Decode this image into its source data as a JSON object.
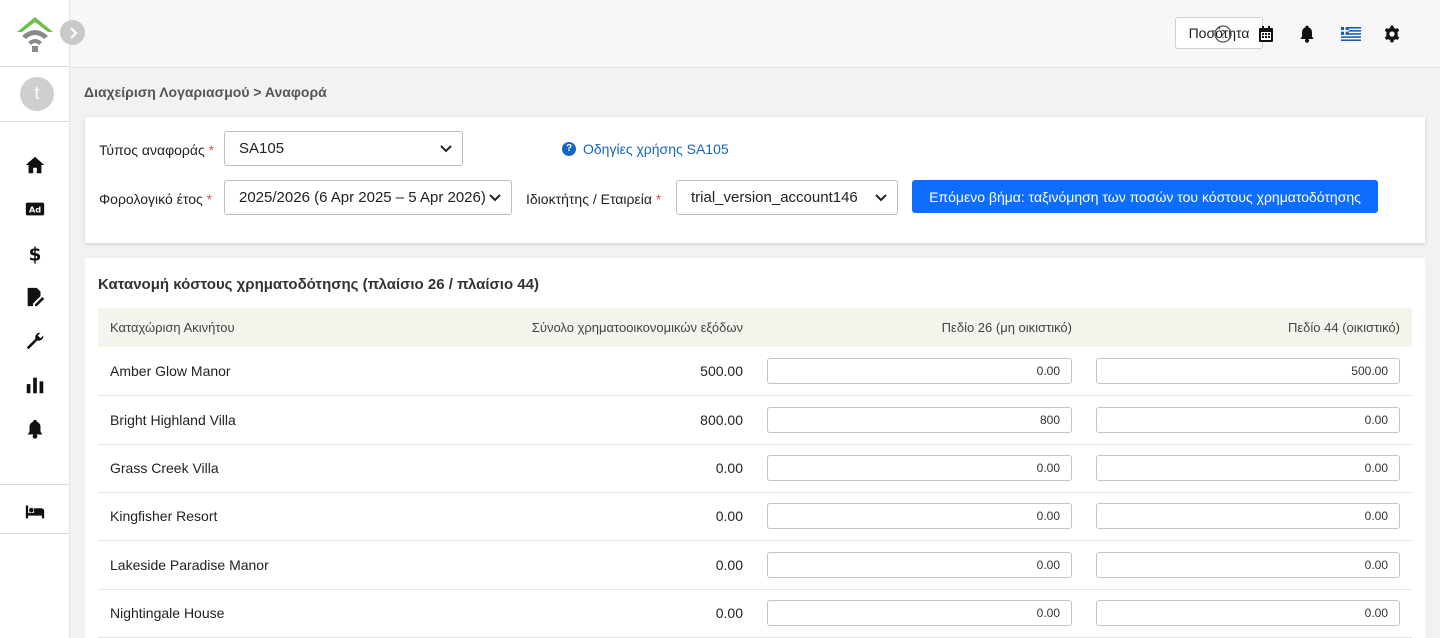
{
  "header": {
    "quantity_button": "Ποσότητα",
    "icons": [
      "help-circle-icon",
      "calendar-icon",
      "bell-icon",
      "greek-flag-icon",
      "gear-icon"
    ]
  },
  "sidebar": {
    "avatar_letter": "t",
    "items": [
      "home-icon",
      "ad-icon",
      "dollar-icon",
      "report-edit-icon",
      "wrench-icon",
      "bar-chart-icon",
      "bell-icon",
      "bed-icon"
    ]
  },
  "breadcrumb": "Διαχείριση Λογαριασμού > Αναφορά",
  "filters": {
    "report_type_label": "Τύπος αναφοράς",
    "report_type_value": "SA105",
    "help_link": "Οδηγίες χρήσης SA105",
    "tax_year_label": "Φορολογικό έτος",
    "tax_year_value": "2025/2026 (6 Apr 2025 – 5 Apr 2026)",
    "owner_label": "Ιδιοκτήτης / Εταιρεία",
    "owner_value": "trial_version_account146",
    "required_mark": "*",
    "next_button": "Επόμενο βήμα: ταξινόμηση των ποσών του κόστους χρηματοδότησης"
  },
  "table": {
    "title": "Κατανομή κόστους χρηματοδότησης (πλαίσιο 26 / πλαίσιο 44)",
    "columns": [
      "Καταχώριση Ακινήτου",
      "Σύνολο χρηματοοικονομικών εξόδων",
      "Πεδίο 26 (μη οικιστικό)",
      "Πεδίο 44 (οικιστικό)"
    ],
    "rows": [
      {
        "name": "Amber Glow Manor",
        "total": "500.00",
        "box26": "0.00",
        "box44": "500.00"
      },
      {
        "name": "Bright Highland Villa",
        "total": "800.00",
        "box26": "800",
        "box44": "0.00"
      },
      {
        "name": "Grass Creek Villa",
        "total": "0.00",
        "box26": "0.00",
        "box44": "0.00"
      },
      {
        "name": "Kingfisher Resort",
        "total": "0.00",
        "box26": "0.00",
        "box44": "0.00"
      },
      {
        "name": "Lakeside Paradise Manor",
        "total": "0.00",
        "box26": "0.00",
        "box44": "0.00"
      },
      {
        "name": "Nightingale House",
        "total": "0.00",
        "box26": "0.00",
        "box44": "0.00"
      }
    ]
  },
  "colors": {
    "primary": "#0d6efd",
    "logo_green": "#6cc04a",
    "logo_gray": "#8a8a8a"
  }
}
